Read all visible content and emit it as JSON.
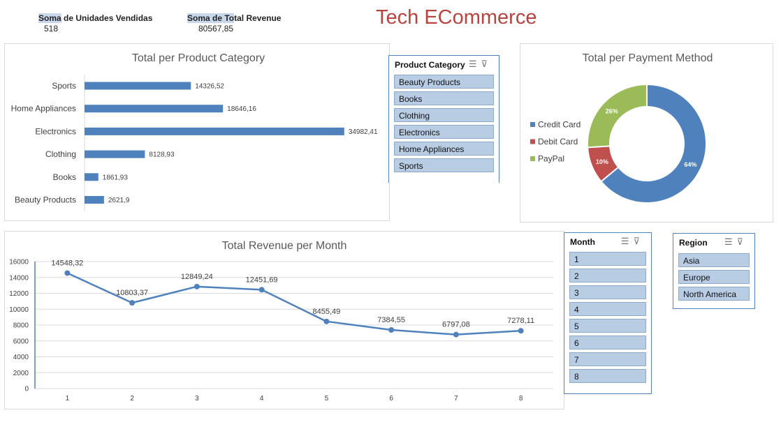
{
  "kpis": {
    "units": {
      "label_hl": "Soma",
      "label_rest": " de Unidades Vendidas",
      "value": "518"
    },
    "revenue": {
      "label_hl": "Soma de To",
      "label_rest": "tal Revenue",
      "value": "80567,85"
    }
  },
  "dashboard_title": "Tech ECommerce",
  "slicers": {
    "category": {
      "header": "Product Category",
      "items": [
        "Beauty Products",
        "Books",
        "Clothing",
        "Electronics",
        "Home Appliances",
        "Sports"
      ]
    },
    "month": {
      "header": "Month",
      "items": [
        "1",
        "2",
        "3",
        "4",
        "5",
        "6",
        "7",
        "8"
      ]
    },
    "region": {
      "header": "Region",
      "items": [
        "Asia",
        "Europe",
        "North America"
      ]
    }
  },
  "chart_data": [
    {
      "type": "bar",
      "orientation": "horizontal",
      "title": "Total per Product Category",
      "categories": [
        "Sports",
        "Home Appliances",
        "Electronics",
        "Clothing",
        "Books",
        "Beauty Products"
      ],
      "values": [
        14326.52,
        18646.16,
        34982.41,
        8128.93,
        1861.93,
        2621.9
      ],
      "value_labels": [
        "14326,52",
        "18646,16",
        "34982,41",
        "8128,93",
        "1861,93",
        "2621,9"
      ],
      "color": "#4f81bd"
    },
    {
      "type": "pie",
      "subtype": "donut",
      "title": "Total per Payment Method",
      "categories": [
        "Credit Card",
        "Debit Card",
        "PayPal"
      ],
      "values": [
        64,
        10,
        26
      ],
      "value_labels": [
        "64%",
        "10%",
        "26%"
      ],
      "colors": [
        "#4f81bd",
        "#c0504d",
        "#9bbb59"
      ],
      "legend_position": "left"
    },
    {
      "type": "line",
      "title": "Total Revenue per Month",
      "x": [
        1,
        2,
        3,
        4,
        5,
        6,
        7,
        8
      ],
      "x_labels": [
        "1",
        "2",
        "3",
        "4",
        "5",
        "6",
        "7",
        "8"
      ],
      "values": [
        14548.32,
        10803.37,
        12849.24,
        12451.69,
        8455.49,
        7384.55,
        6797.08,
        7278.11
      ],
      "value_labels": [
        "14548,32",
        "10803,37",
        "12849,24",
        "12451,69",
        "8455,49",
        "7384,55",
        "6797,08",
        "7278,11"
      ],
      "ylim": [
        0,
        16000
      ],
      "yticks": [
        "0",
        "2000",
        "4000",
        "6000",
        "8000",
        "10000",
        "12000",
        "14000",
        "16000"
      ],
      "grid": true,
      "color": "#4f81bd"
    }
  ]
}
